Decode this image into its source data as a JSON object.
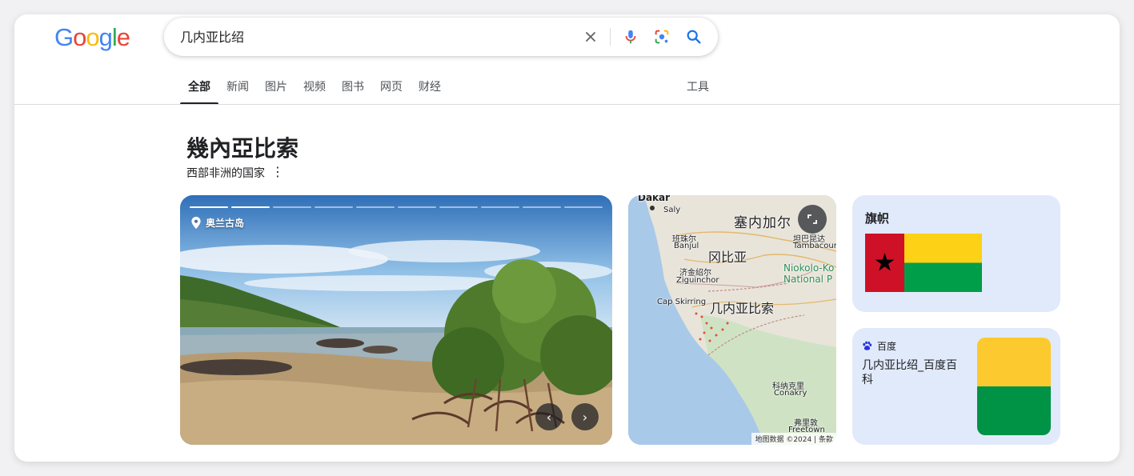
{
  "logo": {
    "letters": [
      "G",
      "o",
      "o",
      "g",
      "l",
      "e"
    ],
    "colors": [
      "#4285F4",
      "#EA4335",
      "#FBBC05",
      "#4285F4",
      "#34A853",
      "#EA4335"
    ]
  },
  "search": {
    "query": "几内亚比绍",
    "placeholder": ""
  },
  "icons": {
    "clear": "close-icon",
    "voice": "microphone-icon",
    "lens": "lens-icon",
    "search": "search-icon",
    "more": "more-vert-icon",
    "pin": "location-pin-icon",
    "prev": "chevron-left-icon",
    "next": "chevron-right-icon",
    "expand": "expand-icon",
    "baidu": "baidu-paw-icon"
  },
  "tabs": [
    {
      "label": "全部",
      "active": true
    },
    {
      "label": "新闻"
    },
    {
      "label": "图片"
    },
    {
      "label": "视频"
    },
    {
      "label": "图书"
    },
    {
      "label": "网页"
    },
    {
      "label": "财经"
    }
  ],
  "tools_label": "工具",
  "entity": {
    "title": "幾內亞比索",
    "subtitle": "西部非洲的国家"
  },
  "photo": {
    "location": "奥兰古岛",
    "total": 10,
    "current": 2
  },
  "map": {
    "labels": [
      "Dakar",
      "Saly",
      "塞内加尔",
      "班珠尔",
      "Banjul",
      "冈比亚",
      "坦巴昆达",
      "Tambacounda",
      "Niokolo-Ko",
      "National P",
      "济金绍尔",
      "Ziguinchor",
      "Cap Skirring",
      "几内亚比索",
      "科纳克里",
      "Conakry",
      "弗里敦",
      "Freetown"
    ],
    "attribution": "地图数据 ©2024",
    "terms": "条款"
  },
  "flag_card": {
    "heading": "旗帜",
    "colors": {
      "red": "#ce1126",
      "yellow": "#fcd116",
      "green": "#009e49"
    }
  },
  "source_card": {
    "site": "百度",
    "title": "几内亚比绍_百度百科"
  },
  "colors": {
    "accent": "#1a73e8",
    "text": "#202124",
    "muted": "#4d5156",
    "card_bg": "#e1eafb"
  }
}
